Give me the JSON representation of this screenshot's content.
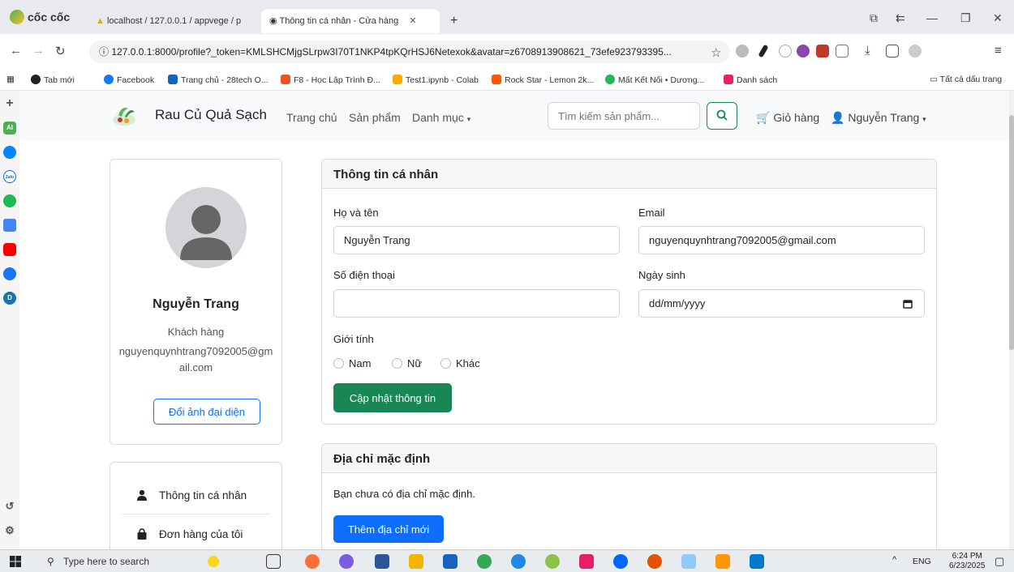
{
  "browser": {
    "brand": "cốc cốc",
    "tabs": [
      {
        "label": "localhost / 127.0.0.1 / appvege / p"
      },
      {
        "label": "Thông tin cá nhân - Cửa hàng",
        "active": true
      }
    ],
    "new_tab": "+",
    "url": "127.0.0.1:8000/profile?_token=KMLSHCMjgSLrpw3I70T1NKP4tpKQrHSJ6Netexok&avatar=z6708913908621_73efe923793395...",
    "bookmarks": [
      "Tab mới",
      "Facebook",
      "Trang chủ - 28tech O...",
      "F8 - Học Lập Trình Đ...",
      "Test1.ipynb - Colab",
      "Rock Star - Lemon 2k...",
      "Mất Kết Nối • Dương...",
      "Danh sách"
    ],
    "all_bookmarks": "Tất cả dấu trang"
  },
  "site": {
    "name": "Rau Củ Quả Sạch",
    "nav": {
      "home": "Trang chủ",
      "products": "Sản phẩm",
      "categories": "Danh mục"
    },
    "search": {
      "placeholder": "Tìm kiếm sản phẩm..."
    },
    "cart": "Giỏ hàng",
    "user": "Nguyễn Trang"
  },
  "profile": {
    "name": "Nguyễn Trang",
    "role": "Khách hàng",
    "email": "nguyenquynhtrang7092005@gmail.com",
    "change_avatar": "Đổi ảnh đại diện"
  },
  "menu": [
    {
      "label": "Thông tin cá nhân"
    },
    {
      "label": "Đơn hàng của tôi"
    }
  ],
  "info_form": {
    "title": "Thông tin cá nhân",
    "fullname_label": "Họ và tên",
    "fullname_value": "Nguyễn Trang",
    "email_label": "Email",
    "email_value": "nguyenquynhtrang7092005@gmail.com",
    "phone_label": "Số điện thoại",
    "phone_value": "",
    "dob_label": "Ngày sinh",
    "dob_value": "dd/mm/yyyy",
    "gender_label": "Giới tính",
    "gender_options": [
      "Nam",
      "Nữ",
      "Khác"
    ],
    "submit": "Cập nhật thông tin"
  },
  "address": {
    "title": "Địa chỉ mặc định",
    "empty_text": "Bạn chưa có địa chỉ mặc định.",
    "add_button": "Thêm địa chỉ mới"
  },
  "taskbar": {
    "search_placeholder": "Type here to search",
    "lang": "ENG",
    "time": "6:24 PM",
    "date": "6/23/2025"
  },
  "colors": {
    "primary": "#0d6efd",
    "success": "#198754",
    "navbar_bg": "#f8f9fa"
  }
}
